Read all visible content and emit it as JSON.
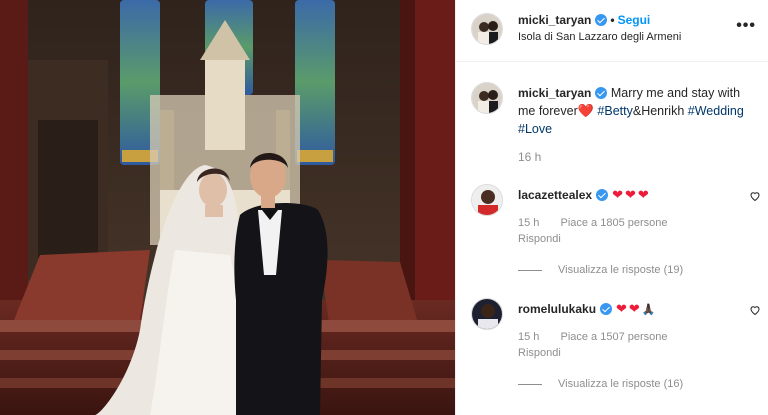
{
  "post": {
    "username": "micki_taryan",
    "follow_label": "Segui",
    "location": "Isola di San Lazzaro degli Armeni",
    "more_label": "•••"
  },
  "caption": {
    "username": "micki_taryan",
    "text_before": "Marry me and stay with me forever",
    "heart": "❤️",
    "tag1": "#Betty",
    "amp": "&Henrikh",
    "tag2": "#Wedding",
    "tag3": "#Love",
    "time": "16 h"
  },
  "comments": [
    {
      "username": "lacazettealex",
      "emoji": "❤❤❤",
      "time": "15 h",
      "likes": "Piace a 1805 persone",
      "reply": "Rispondi",
      "view_replies": "Visualizza le risposte (19)"
    },
    {
      "username": "romelulukaku",
      "emoji": "❤❤",
      "emoji_extra": "🙏🏿",
      "time": "15 h",
      "likes": "Piace a 1507 persone",
      "reply": "Rispondi",
      "view_replies": "Visualizza le risposte (16)"
    }
  ],
  "icons": {
    "like": "heart-outline-icon",
    "verified": "verified-badge-icon"
  },
  "colors": {
    "link_blue": "#0095f6",
    "verified_blue": "#3897f0",
    "hashtag": "#00376b",
    "heart_red": "#ed1c3a",
    "muted": "#8e8e8e"
  }
}
